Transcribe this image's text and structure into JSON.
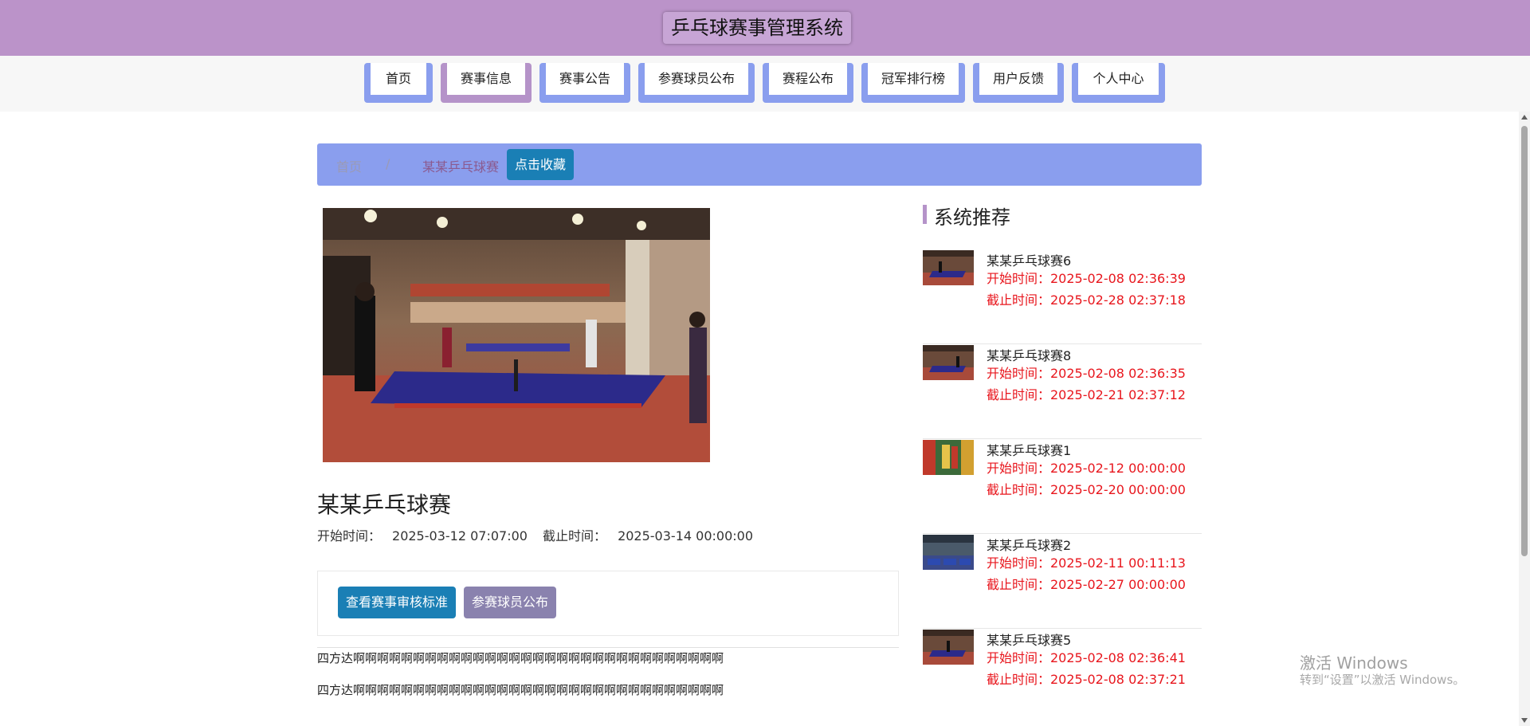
{
  "header": {
    "title": "乒乓球赛事管理系统"
  },
  "nav": {
    "items": [
      {
        "label": "首页"
      },
      {
        "label": "赛事信息"
      },
      {
        "label": "赛事公告"
      },
      {
        "label": "参赛球员公布"
      },
      {
        "label": "赛程公布"
      },
      {
        "label": "冠军排行榜"
      },
      {
        "label": "用户反馈"
      },
      {
        "label": "个人中心"
      }
    ],
    "active": "赛事信息"
  },
  "breadcrumb": {
    "home": "首页",
    "separator": "/",
    "current": "某某乒乓球赛",
    "collect_button": "点击收藏"
  },
  "event": {
    "title": "某某乒乓球赛",
    "start_label": "开始时间：",
    "start_value": "2025-03-12 07:07:00",
    "end_label": "截止时间：",
    "end_value": "2025-03-14 00:00:00",
    "criteria_button": "查看赛事审核标准",
    "players_button": "参赛球员公布",
    "content_lines": [
      "四方达啊啊啊啊啊啊啊啊啊啊啊啊啊啊啊啊啊啊啊啊啊啊啊啊啊啊啊啊啊啊啊",
      "四方达啊啊啊啊啊啊啊啊啊啊啊啊啊啊啊啊啊啊啊啊啊啊啊啊啊啊啊啊啊啊啊"
    ]
  },
  "recommend": {
    "title": "系统推荐",
    "items": [
      {
        "name": "某某乒乓球赛6",
        "start": "开始时间：2025-02-08 02:36:39",
        "end": "截止时间：2025-02-28 02:37:18"
      },
      {
        "name": "某某乒乓球赛8",
        "start": "开始时间：2025-02-08 02:36:35",
        "end": "截止时间：2025-02-21 02:37:12"
      },
      {
        "name": "某某乒乓球赛1",
        "start": "开始时间：2025-02-12 00:00:00",
        "end": "截止时间：2025-02-20 00:00:00"
      },
      {
        "name": "某某乒乓球赛2",
        "start": "开始时间：2025-02-11 00:11:13",
        "end": "截止时间：2025-02-27 00:00:00"
      },
      {
        "name": "某某乒乓球赛5",
        "start": "开始时间：2025-02-08 02:36:41",
        "end": "截止时间：2025-02-08 02:37:21"
      }
    ]
  },
  "watermark": {
    "line1": "激活 Windows",
    "line2": "转到“设置”以激活 Windows。"
  },
  "colors": {
    "header_bg": "#bb93c9",
    "nav_tab": "#8a9eee",
    "nav_tab_active": "#b593c9",
    "primary_button": "#1a7fb5",
    "secondary_button": "#8a82ae",
    "time_text": "#e8161d"
  }
}
